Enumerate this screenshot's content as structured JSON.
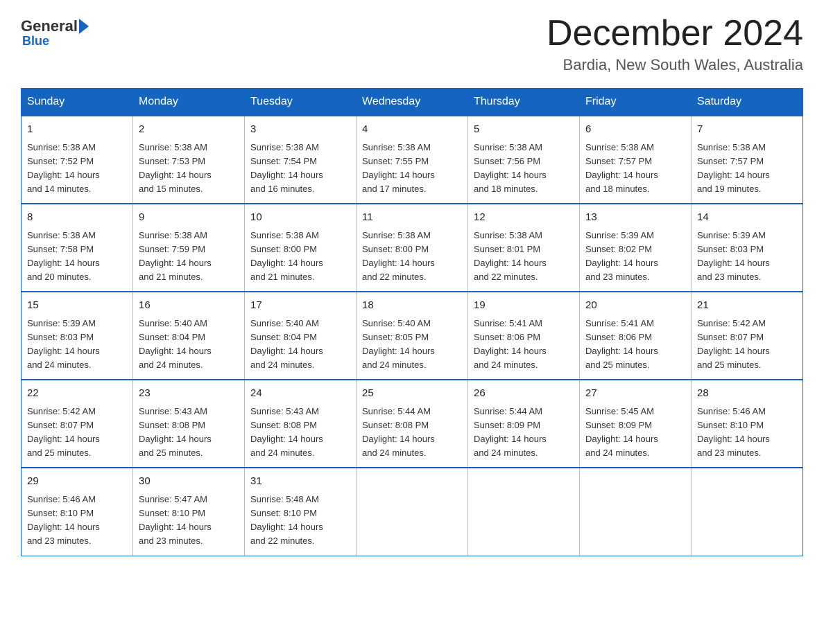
{
  "header": {
    "logo_general": "General",
    "logo_blue": "Blue",
    "main_title": "December 2024",
    "subtitle": "Bardia, New South Wales, Australia"
  },
  "calendar": {
    "days_of_week": [
      "Sunday",
      "Monday",
      "Tuesday",
      "Wednesday",
      "Thursday",
      "Friday",
      "Saturday"
    ],
    "weeks": [
      [
        {
          "day": "1",
          "sunrise": "5:38 AM",
          "sunset": "7:52 PM",
          "daylight": "14 hours and 14 minutes."
        },
        {
          "day": "2",
          "sunrise": "5:38 AM",
          "sunset": "7:53 PM",
          "daylight": "14 hours and 15 minutes."
        },
        {
          "day": "3",
          "sunrise": "5:38 AM",
          "sunset": "7:54 PM",
          "daylight": "14 hours and 16 minutes."
        },
        {
          "day": "4",
          "sunrise": "5:38 AM",
          "sunset": "7:55 PM",
          "daylight": "14 hours and 17 minutes."
        },
        {
          "day": "5",
          "sunrise": "5:38 AM",
          "sunset": "7:56 PM",
          "daylight": "14 hours and 18 minutes."
        },
        {
          "day": "6",
          "sunrise": "5:38 AM",
          "sunset": "7:57 PM",
          "daylight": "14 hours and 18 minutes."
        },
        {
          "day": "7",
          "sunrise": "5:38 AM",
          "sunset": "7:57 PM",
          "daylight": "14 hours and 19 minutes."
        }
      ],
      [
        {
          "day": "8",
          "sunrise": "5:38 AM",
          "sunset": "7:58 PM",
          "daylight": "14 hours and 20 minutes."
        },
        {
          "day": "9",
          "sunrise": "5:38 AM",
          "sunset": "7:59 PM",
          "daylight": "14 hours and 21 minutes."
        },
        {
          "day": "10",
          "sunrise": "5:38 AM",
          "sunset": "8:00 PM",
          "daylight": "14 hours and 21 minutes."
        },
        {
          "day": "11",
          "sunrise": "5:38 AM",
          "sunset": "8:00 PM",
          "daylight": "14 hours and 22 minutes."
        },
        {
          "day": "12",
          "sunrise": "5:38 AM",
          "sunset": "8:01 PM",
          "daylight": "14 hours and 22 minutes."
        },
        {
          "day": "13",
          "sunrise": "5:39 AM",
          "sunset": "8:02 PM",
          "daylight": "14 hours and 23 minutes."
        },
        {
          "day": "14",
          "sunrise": "5:39 AM",
          "sunset": "8:03 PM",
          "daylight": "14 hours and 23 minutes."
        }
      ],
      [
        {
          "day": "15",
          "sunrise": "5:39 AM",
          "sunset": "8:03 PM",
          "daylight": "14 hours and 24 minutes."
        },
        {
          "day": "16",
          "sunrise": "5:40 AM",
          "sunset": "8:04 PM",
          "daylight": "14 hours and 24 minutes."
        },
        {
          "day": "17",
          "sunrise": "5:40 AM",
          "sunset": "8:04 PM",
          "daylight": "14 hours and 24 minutes."
        },
        {
          "day": "18",
          "sunrise": "5:40 AM",
          "sunset": "8:05 PM",
          "daylight": "14 hours and 24 minutes."
        },
        {
          "day": "19",
          "sunrise": "5:41 AM",
          "sunset": "8:06 PM",
          "daylight": "14 hours and 24 minutes."
        },
        {
          "day": "20",
          "sunrise": "5:41 AM",
          "sunset": "8:06 PM",
          "daylight": "14 hours and 25 minutes."
        },
        {
          "day": "21",
          "sunrise": "5:42 AM",
          "sunset": "8:07 PM",
          "daylight": "14 hours and 25 minutes."
        }
      ],
      [
        {
          "day": "22",
          "sunrise": "5:42 AM",
          "sunset": "8:07 PM",
          "daylight": "14 hours and 25 minutes."
        },
        {
          "day": "23",
          "sunrise": "5:43 AM",
          "sunset": "8:08 PM",
          "daylight": "14 hours and 25 minutes."
        },
        {
          "day": "24",
          "sunrise": "5:43 AM",
          "sunset": "8:08 PM",
          "daylight": "14 hours and 24 minutes."
        },
        {
          "day": "25",
          "sunrise": "5:44 AM",
          "sunset": "8:08 PM",
          "daylight": "14 hours and 24 minutes."
        },
        {
          "day": "26",
          "sunrise": "5:44 AM",
          "sunset": "8:09 PM",
          "daylight": "14 hours and 24 minutes."
        },
        {
          "day": "27",
          "sunrise": "5:45 AM",
          "sunset": "8:09 PM",
          "daylight": "14 hours and 24 minutes."
        },
        {
          "day": "28",
          "sunrise": "5:46 AM",
          "sunset": "8:10 PM",
          "daylight": "14 hours and 23 minutes."
        }
      ],
      [
        {
          "day": "29",
          "sunrise": "5:46 AM",
          "sunset": "8:10 PM",
          "daylight": "14 hours and 23 minutes."
        },
        {
          "day": "30",
          "sunrise": "5:47 AM",
          "sunset": "8:10 PM",
          "daylight": "14 hours and 23 minutes."
        },
        {
          "day": "31",
          "sunrise": "5:48 AM",
          "sunset": "8:10 PM",
          "daylight": "14 hours and 22 minutes."
        },
        null,
        null,
        null,
        null
      ]
    ]
  },
  "labels": {
    "sunrise_label": "Sunrise:",
    "sunset_label": "Sunset:",
    "daylight_label": "Daylight:"
  }
}
